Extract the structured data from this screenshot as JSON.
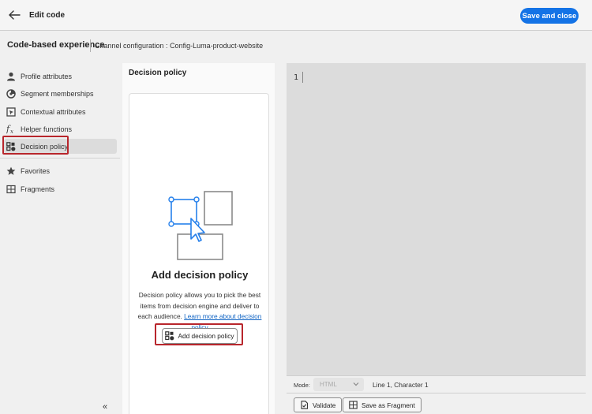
{
  "header": {
    "title": "Edit code",
    "save_label": "Save and close",
    "accent_color": "#1473e6"
  },
  "subheader": {
    "title": "Code-based experience",
    "config": "Channel configuration : Config-Luma-product-website"
  },
  "sidebar": {
    "items": [
      {
        "label": "Profile attributes",
        "icon": "person-icon"
      },
      {
        "label": "Segment memberships",
        "icon": "segment-icon"
      },
      {
        "label": "Contextual attributes",
        "icon": "contextual-icon"
      },
      {
        "label": "Helper functions",
        "icon": "function-icon"
      },
      {
        "label": "Decision policy",
        "icon": "decision-policy-icon",
        "active": true
      },
      {
        "label": "Favorites",
        "icon": "star-icon"
      },
      {
        "label": "Fragments",
        "icon": "fragment-icon"
      }
    ],
    "collapse_glyph": "«"
  },
  "middle": {
    "title": "Decision policy",
    "heading": "Add decision policy",
    "description": "Decision policy allows you to pick the best items from decision engine and deliver to each audience.",
    "link_text": "Learn more about decision policy",
    "button_label": "Add decision policy"
  },
  "editor": {
    "line_number": "1"
  },
  "mode_bar": {
    "mode_label": "Mode:",
    "mode_value": "HTML",
    "position": "Line 1, Character 1"
  },
  "actions": {
    "validate_label": "Validate",
    "fragment_label": "Save as Fragment"
  },
  "colors": {
    "highlight": "#b8262c",
    "illustration_blue": "#2680eb"
  }
}
